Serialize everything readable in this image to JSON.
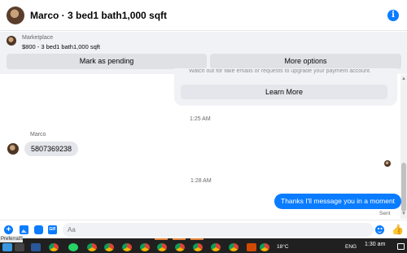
{
  "header": {
    "title": "Marco · 3 bed1 bath1,000 sqft",
    "info_icon": "info-icon"
  },
  "marketplace": {
    "label": "Marketplace",
    "listing": "$800 - 3 bed1 bath1,000 sqft",
    "pending_button": "Mark as pending",
    "more_button": "More options"
  },
  "chat": {
    "system_notice": "Watch out for fake emails or requests to upgrade your payment account.",
    "learn_more": "Learn More",
    "time_1": "1:25 AM",
    "sender_name": "Marco",
    "incoming_message": "5807369238",
    "time_2": "1:28 AM",
    "outgoing_message": "Thanks I'll message you in a moment",
    "status": "Sent"
  },
  "composer": {
    "placeholder": "Aa",
    "icons": [
      "plus-icon",
      "image-icon",
      "sticker-icon",
      "gif-icon",
      "emoji-icon",
      "like-icon"
    ]
  },
  "taskbar": {
    "file_tab": "PreferralS...",
    "weather": "18°C",
    "language": "ENG",
    "time": "1:30 am"
  },
  "colors": {
    "accent": "#0a7cff",
    "bubble_in": "#e4e6eb",
    "panel": "#f0f2f5",
    "taskbar": "#202020"
  }
}
